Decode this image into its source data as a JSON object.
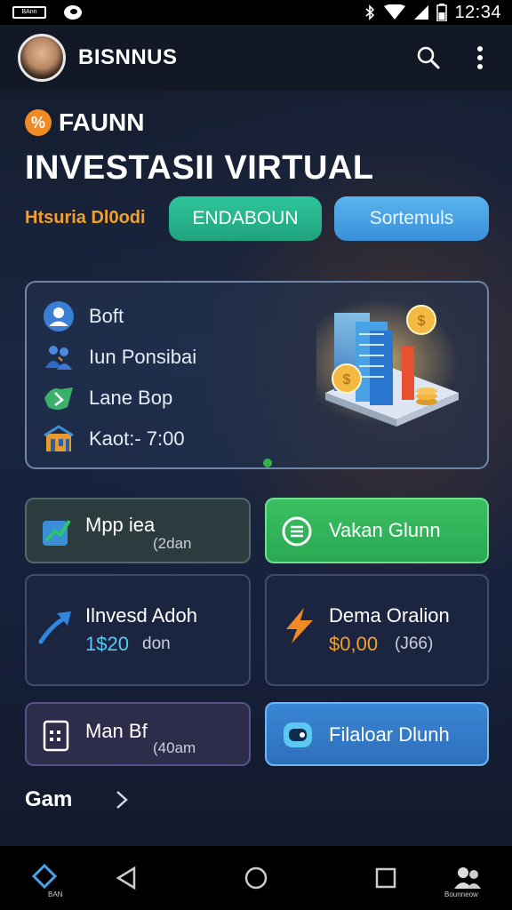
{
  "status_bar": {
    "left_badge": "BAnn",
    "time": "12:34"
  },
  "app_bar": {
    "brand": "BISNNUS"
  },
  "section": {
    "tag": "FAUNN",
    "title": "INVESTASII VIRTUAL",
    "subtitle": "Htsuria Dl0odi",
    "primary_button": "ENDABOUN",
    "secondary_button": "Sortemuls"
  },
  "info_card": {
    "rows": [
      {
        "label": "Boft",
        "icon": "user-icon"
      },
      {
        "label": "Iun Ponsibai",
        "icon": "people-icon"
      },
      {
        "label": "Lane Bop",
        "icon": "money-icon"
      },
      {
        "label": "Kaot:- 7:00",
        "icon": "building-icon"
      }
    ]
  },
  "tiles": {
    "mpp": {
      "label": "Mpp iea",
      "sub": "(2dan",
      "icon": "chart-box-icon"
    },
    "vakan": {
      "label": "Vakan Glunn",
      "icon": "list-circle-icon"
    },
    "invest": {
      "label": "Ilnvesd Adoh",
      "value": "1$20",
      "unit": "don",
      "icon": "trend-up-icon"
    },
    "dema": {
      "label": "Dema Oralion",
      "value": "$0,00",
      "unit": "(J66)",
      "icon": "lightning-icon"
    },
    "man": {
      "label": "Man Bf",
      "sub": "(40am",
      "icon": "phone-calc-icon"
    },
    "filaloar": {
      "label": "Filaloar Dlunh",
      "icon": "robot-icon"
    }
  },
  "more": {
    "label": "Gam"
  },
  "nav": {
    "left_caption": "BAN",
    "right_caption": "Bounneow"
  },
  "colors": {
    "accent_orange": "#f0a030",
    "green": "#2fc59a",
    "blue": "#4aa2e6",
    "highlight_blue": "#5ac8f0"
  }
}
